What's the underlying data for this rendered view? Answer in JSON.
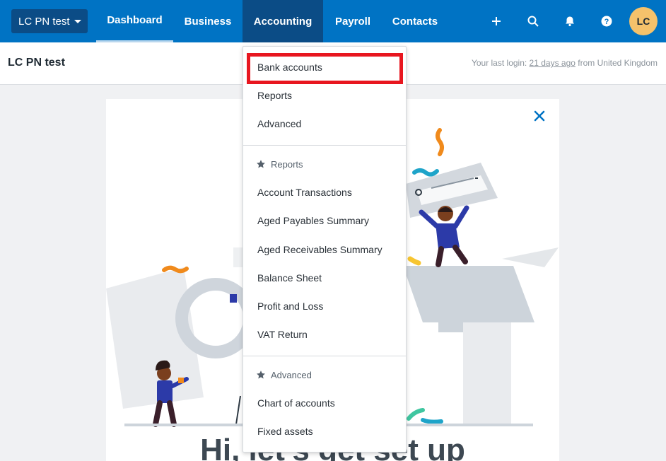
{
  "topnav": {
    "org_name": "LC PN test",
    "tabs": [
      {
        "label": "Dashboard"
      },
      {
        "label": "Business"
      },
      {
        "label": "Accounting"
      },
      {
        "label": "Payroll"
      },
      {
        "label": "Contacts"
      }
    ],
    "icons": [
      "plus-icon",
      "search-icon",
      "bell-icon",
      "help-icon"
    ],
    "avatar_initials": "LC"
  },
  "subheader": {
    "title": "LC PN test",
    "last_login_prefix": "Your last login: ",
    "last_login_ago": "21 days ago",
    "last_login_suffix": " from United Kingdom"
  },
  "accounting_menu": {
    "items": [
      "Bank accounts",
      "Reports",
      "Advanced"
    ],
    "reports_section": {
      "heading": "Reports",
      "items": [
        "Account Transactions",
        "Aged Payables Summary",
        "Aged Receivables Summary",
        "Balance Sheet",
        "Profit and Loss",
        "VAT Return"
      ]
    },
    "advanced_section": {
      "heading": "Advanced",
      "items": [
        "Chart of accounts",
        "Fixed assets"
      ]
    }
  },
  "welcome_card": {
    "heading": "Hi, let's get set up"
  },
  "colors": {
    "nav_blue": "#0073c4",
    "nav_active": "#0b4c86",
    "highlight_red": "#e8161f",
    "avatar": "#f5c26b"
  }
}
